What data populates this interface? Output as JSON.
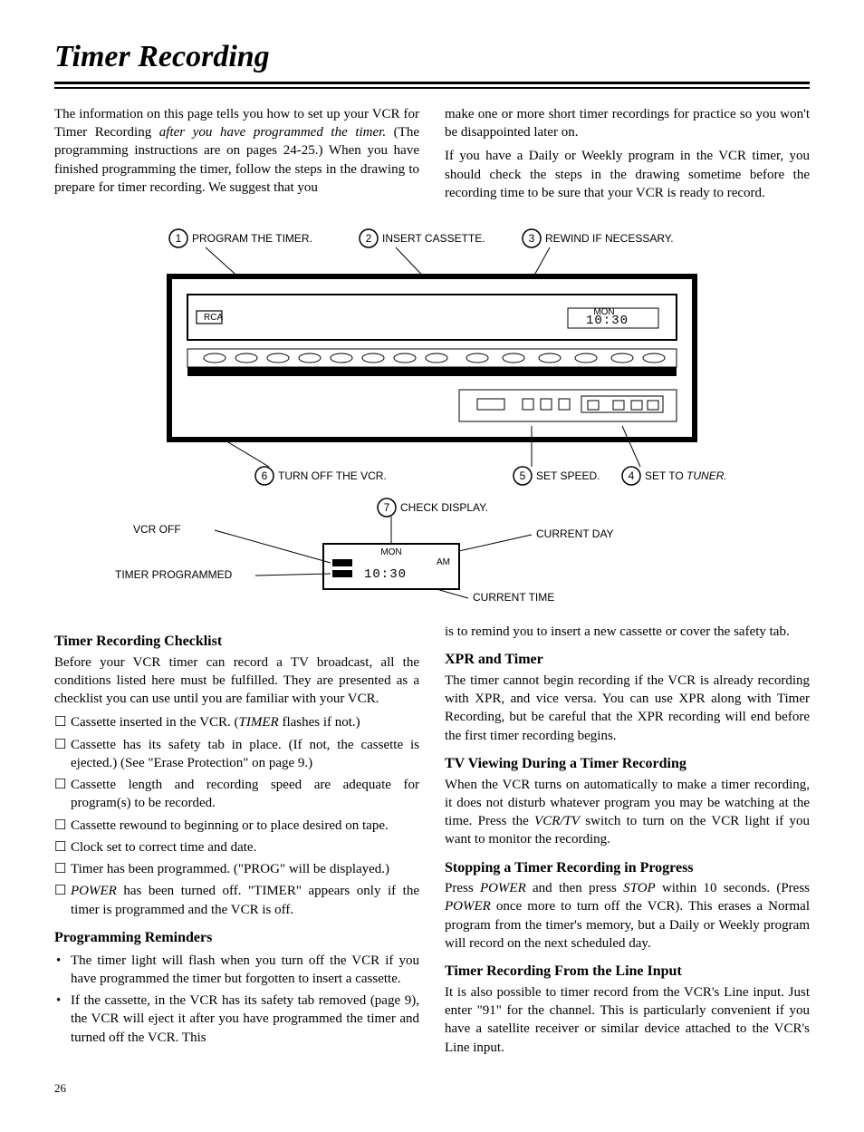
{
  "title": "Timer Recording",
  "intro_left": "The information on this page tells you how to set up your VCR for Timer Recording ",
  "intro_left_ital": "after you have programmed the timer.",
  "intro_left2": " (The programming instructions are on pages 24-25.) When you have finished programming the timer, follow the steps in the drawing to prepare for timer recording. We suggest that you",
  "intro_right": "make one or more short timer recordings for practice so you won't be disappointed later on.",
  "intro_right2": "If you have a Daily or Weekly program in the VCR timer, you should check the steps in the drawing sometime before the recording time to be sure that your VCR is ready to record.",
  "steps": {
    "s1": "PROGRAM THE TIMER.",
    "s2": "INSERT CASSETTE.",
    "s3": "REWIND IF NECESSARY.",
    "s4": "SET TO ",
    "s4_ital": "TUNER.",
    "s5": "SET SPEED.",
    "s6": "TURN OFF THE VCR.",
    "s7": "CHECK DISPLAY."
  },
  "callouts": {
    "vcr_off": "VCR OFF",
    "timer_programmed": "TIMER PROGRAMMED",
    "current_day": "CURRENT DAY",
    "current_time": "CURRENT TIME",
    "mon": "MON",
    "time": "10:30",
    "am": "AM",
    "rca": "RCA",
    "mon_small": "MON",
    "time_small": "10:30"
  },
  "sections": {
    "checklist_h": "Timer Recording Checklist",
    "checklist_p": "Before your VCR timer can record a TV broadcast, all the conditions listed here must be fulfilled. They are presented as a checklist you can use until you are familiar with your VCR.",
    "checklist": [
      {
        "pre": "Cassette inserted in the VCR. (",
        "ital": "TIMER",
        "post": " flashes if not.)"
      },
      {
        "pre": "Cassette has its safety tab in place. (If not, the cassette is ejected.) (See \"Erase Protection\" on page 9.)",
        "ital": "",
        "post": ""
      },
      {
        "pre": "Cassette length and recording speed are adequate for program(s) to be recorded.",
        "ital": "",
        "post": ""
      },
      {
        "pre": "Cassette rewound to beginning or to place desired on tape.",
        "ital": "",
        "post": ""
      },
      {
        "pre": "Clock set to correct time and date.",
        "ital": "",
        "post": ""
      },
      {
        "pre": "Timer has been programmed. (\"PROG\" will be displayed.)",
        "ital": "",
        "post": ""
      },
      {
        "pre": "",
        "ital": "POWER",
        "post": " has been turned off. \"TIMER\" appears only if the timer is programmed and the VCR is off."
      }
    ],
    "prog_h": "Programming Reminders",
    "prog_b1": "The timer light will flash when you turn off the VCR if you have programmed the timer but forgotten to insert a cassette.",
    "prog_b2": "If the cassette, in the VCR has its safety tab removed (page 9), the VCR will eject it after you have programmed the timer and turned off the VCR. This",
    "prog_cont": "is to remind you to insert a new cassette or cover the safety tab.",
    "xpr_h": "XPR and Timer",
    "xpr_p": "The timer cannot begin recording if the VCR is already recording with XPR, and vice versa. You can use XPR along with Timer Recording, but be careful that the XPR recording will end before the first timer recording begins.",
    "tv_h": "TV Viewing During a Timer Recording",
    "tv_p1": "When the VCR turns on automatically to make a timer recording, it does not disturb whatever program you may be watching at the time. Press the ",
    "tv_ital": "VCR/TV",
    "tv_p2": " switch to turn on the VCR light if you want to monitor the recording.",
    "stop_h": "Stopping a Timer Recording in Progress",
    "stop_p1": "Press ",
    "stop_i1": "POWER",
    "stop_p2": " and then press ",
    "stop_i2": "STOP",
    "stop_p3": " within 10 seconds. (Press ",
    "stop_i3": "POWER",
    "stop_p4": " once more to turn off the VCR). This erases a Normal program from the timer's memory, but a Daily or Weekly program will record on the next scheduled day.",
    "line_h": "Timer Recording From the Line Input",
    "line_p": "It is also possible to timer record from the VCR's Line input. Just enter \"91\" for the channel. This is particularly convenient if you have a satellite receiver or similar device attached to the VCR's Line input."
  },
  "page": "26"
}
